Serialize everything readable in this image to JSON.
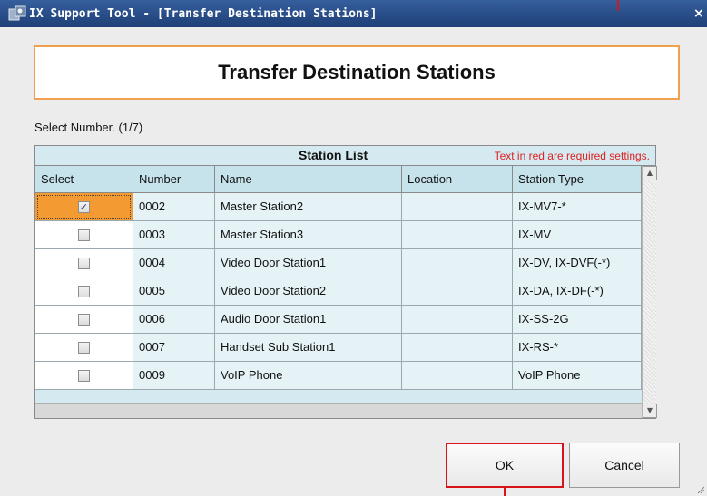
{
  "window": {
    "title": "IX Support Tool - [Transfer Destination Stations]",
    "close_glyph": "×"
  },
  "header": {
    "title": "Transfer Destination Stations"
  },
  "select_number": "Select Number. (1/7)",
  "grid": {
    "caption": "Station List",
    "note": "Text in red are required settings.",
    "columns": [
      "Select",
      "Number",
      "Name",
      "Location",
      "Station Type"
    ],
    "rows": [
      {
        "checked": true,
        "number": "0002",
        "name": "Master Station2",
        "location": "",
        "type": "IX-MV7-*"
      },
      {
        "checked": false,
        "number": "0003",
        "name": "Master Station3",
        "location": "",
        "type": "IX-MV"
      },
      {
        "checked": false,
        "number": "0004",
        "name": "Video Door Station1",
        "location": "",
        "type": "IX-DV, IX-DVF(-*)"
      },
      {
        "checked": false,
        "number": "0005",
        "name": "Video Door Station2",
        "location": "",
        "type": "IX-DA, IX-DF(-*)"
      },
      {
        "checked": false,
        "number": "0006",
        "name": "Audio Door Station1",
        "location": "",
        "type": "IX-SS-2G"
      },
      {
        "checked": false,
        "number": "0007",
        "name": "Handset Sub Station1",
        "location": "",
        "type": "IX-RS-*"
      },
      {
        "checked": false,
        "number": "0009",
        "name": "VoIP Phone",
        "location": "",
        "type": "VoIP Phone"
      }
    ]
  },
  "buttons": {
    "ok": "OK",
    "cancel": "Cancel"
  },
  "colors": {
    "title_bar": "#1f3f77",
    "header_border": "#f0a050",
    "grid_bg": "#d4eaf0",
    "selected_cell": "#f39a32",
    "required_text": "#e02020",
    "callout": "#d8141b"
  },
  "icons": {
    "app": "ix-support-tool-icon",
    "scroll_up": "arrow-up-icon",
    "scroll_down": "arrow-down-icon",
    "checkmark": "checkmark-icon"
  }
}
